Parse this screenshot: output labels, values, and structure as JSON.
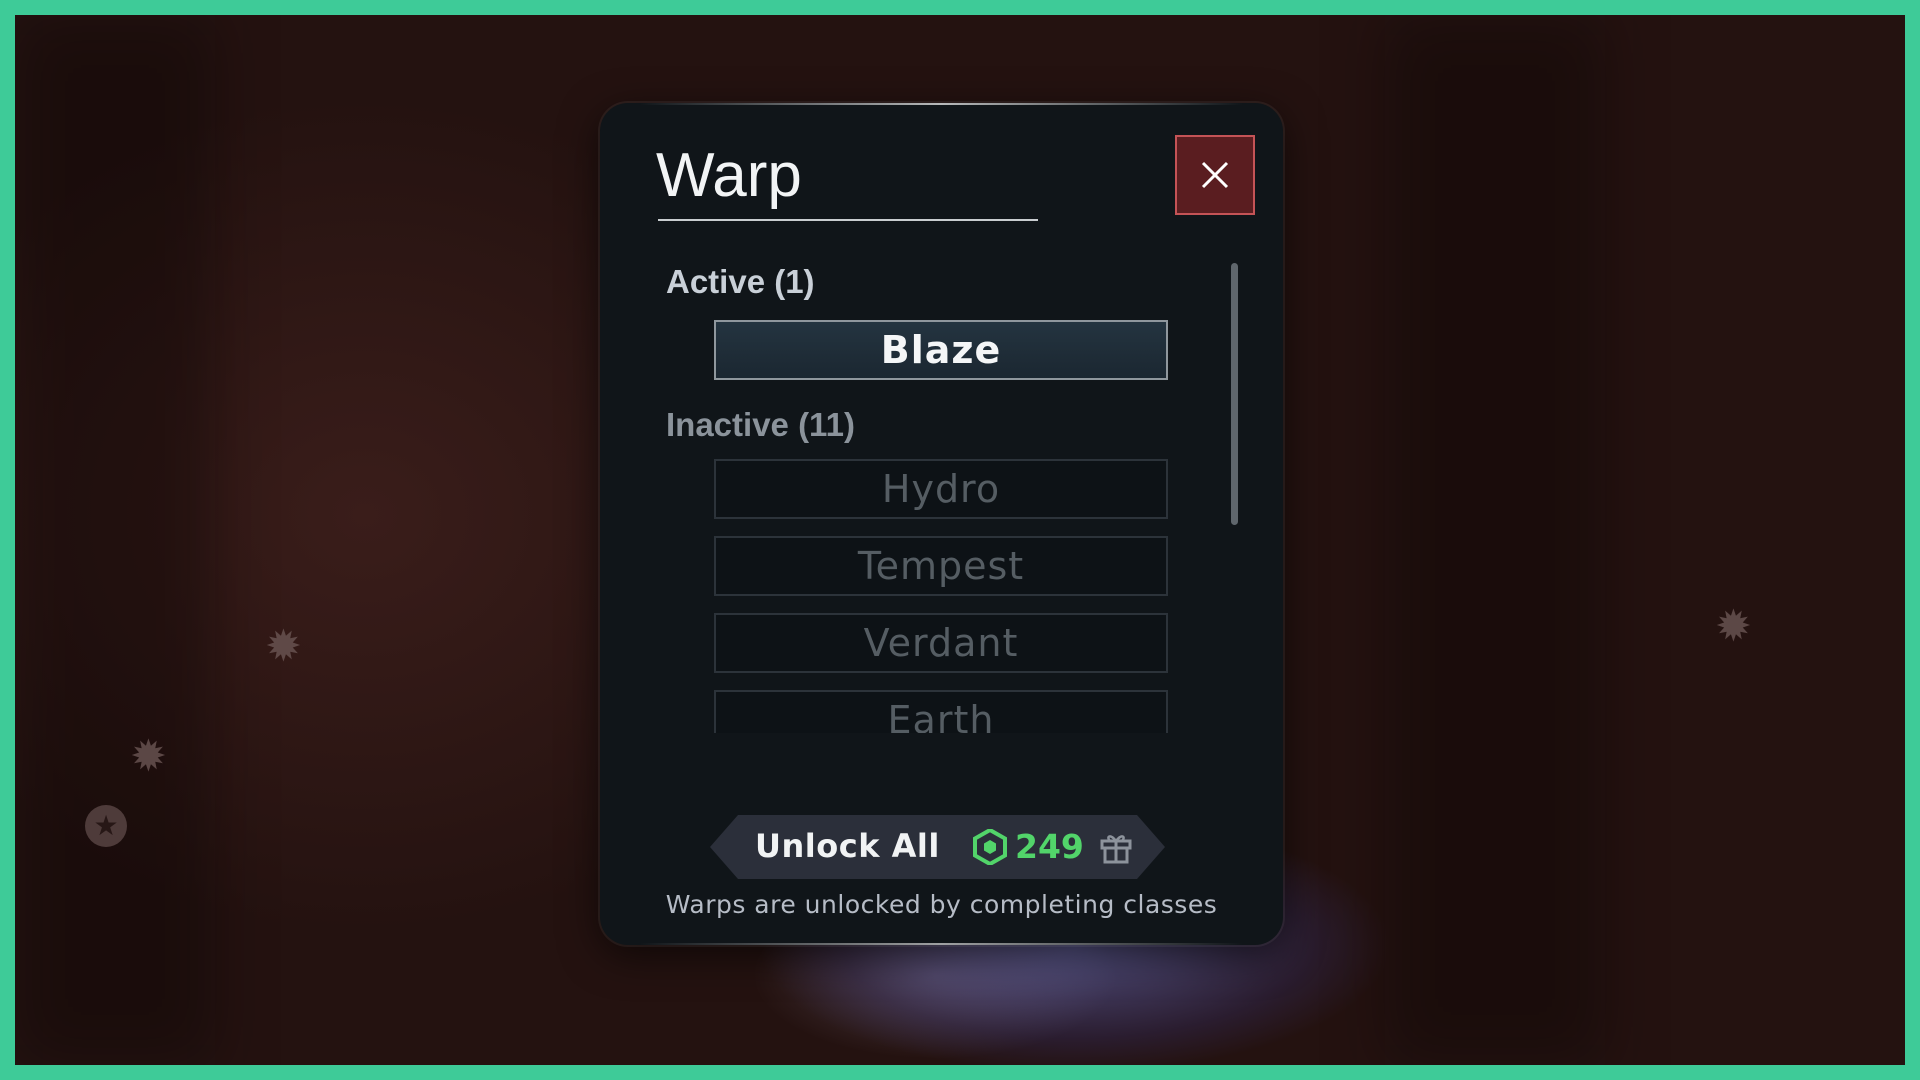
{
  "modal": {
    "title": "Warp",
    "close_label": "X",
    "active_section": "Active (1)",
    "active_items": [
      "Blaze"
    ],
    "inactive_section": "Inactive (11)",
    "inactive_items": [
      "Hydro",
      "Tempest",
      "Verdant",
      "Earth"
    ],
    "unlock": {
      "label": "Unlock All",
      "currency_icon": "robux-icon",
      "price": "249",
      "gift_icon": "gift-icon"
    },
    "note": "Warps are unlocked by completing classes"
  },
  "colors": {
    "frame": "#3ecb98",
    "modal_bg": "#101519",
    "close_bg": "#5a1d20",
    "price": "#52d46a"
  }
}
